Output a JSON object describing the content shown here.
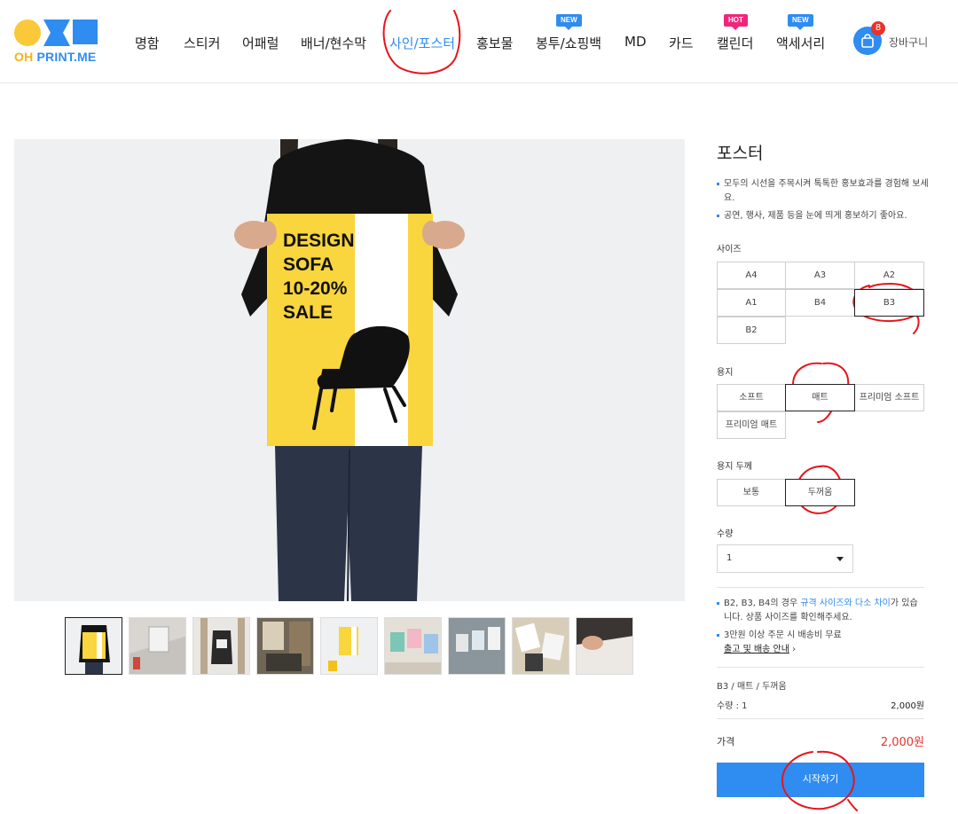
{
  "header": {
    "logo": {
      "oh": "OH",
      "rest": "PRINT.ME"
    },
    "nav": [
      {
        "label": "명함"
      },
      {
        "label": "스티커"
      },
      {
        "label": "어패럴"
      },
      {
        "label": "배너/현수막"
      },
      {
        "label": "사인/포스터",
        "active": true
      },
      {
        "label": "홍보물"
      },
      {
        "label": "봉투/쇼핑백",
        "badge": "NEW"
      },
      {
        "label": "MD"
      },
      {
        "label": "카드"
      },
      {
        "label": "캘린더",
        "badge": "HOT"
      },
      {
        "label": "액세서리",
        "badge": "NEW"
      }
    ],
    "cart": {
      "count": "8",
      "label": "장바구니"
    }
  },
  "product": {
    "title": "포스터",
    "description": [
      "모두의 시선을 주목시켜 톡톡한 홍보효과를 경험해 보세요.",
      "공연, 행사, 제품 등을 눈에 띄게 홍보하기 좋아요."
    ],
    "poster_text": [
      "DESIGN",
      "SOFA",
      "10-20%",
      "SALE"
    ],
    "thumbnail_count": 9
  },
  "options": {
    "size": {
      "label": "사이즈",
      "items": [
        "A4",
        "A3",
        "A2",
        "A1",
        "B4",
        "B3",
        "B2"
      ],
      "selected": "B3"
    },
    "paper": {
      "label": "용지",
      "items": [
        "소프트",
        "매트",
        "프리미엄 소프트",
        "프리미엄 매트"
      ],
      "selected": "매트"
    },
    "thickness": {
      "label": "용지 두께",
      "items": [
        "보통",
        "두꺼움"
      ],
      "selected": "두꺼움"
    },
    "quantity": {
      "label": "수량",
      "value": "1"
    }
  },
  "notes": {
    "note1_prefix": "B2, B3, B4의 경우 ",
    "note1_link": "규격 사이즈와 다소 차이",
    "note1_suffix": "가 있습니다. 상품 사이즈를 확인해주세요.",
    "note2": "3만원 이상 주문 시 배송비 무료",
    "note2_link": "출고 및 배송 안내"
  },
  "summary": {
    "selection": "B3 / 매트 / 두꺼움",
    "qty_label": "수량 : 1",
    "qty_price": "2,000원",
    "price_label": "가격",
    "price_value": "2,000원",
    "start_button": "시작하기"
  },
  "colors": {
    "accent": "#2f8cf0",
    "price": "#e8322b",
    "poster_yellow": "#f9d53e",
    "markup_red": "#e8141c"
  }
}
